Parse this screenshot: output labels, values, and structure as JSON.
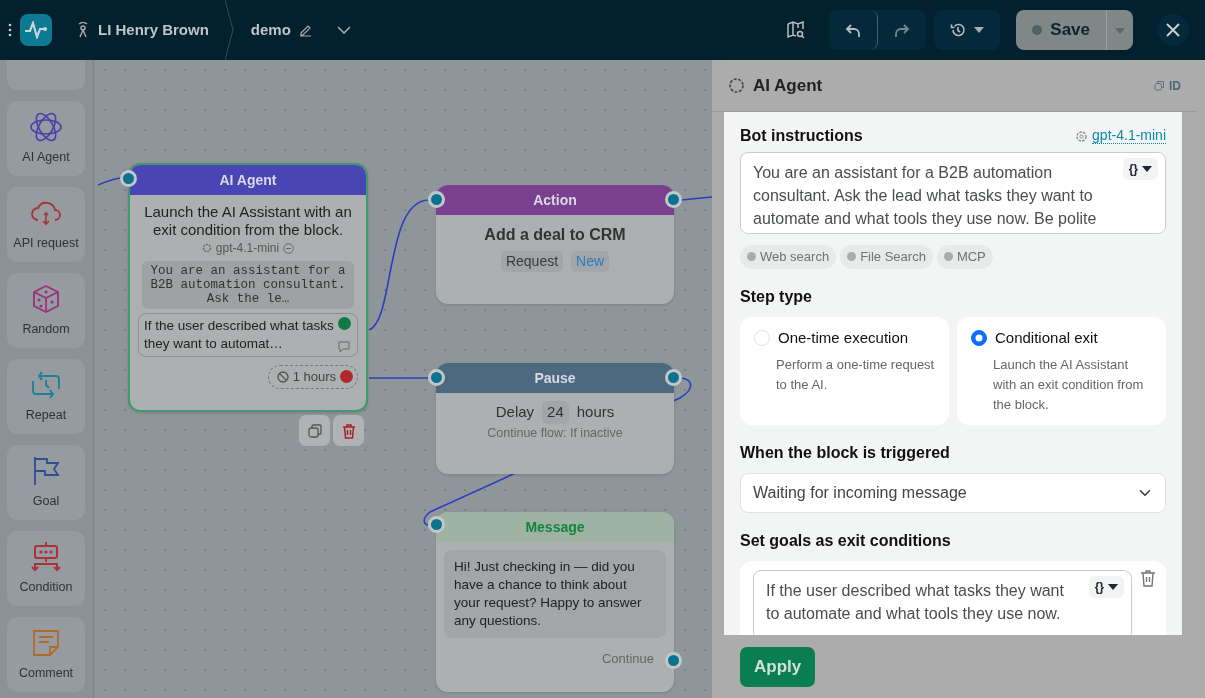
{
  "topbar": {
    "account_name": "LI Henry Brown",
    "flow_name": "demo",
    "save_label": "Save"
  },
  "palette": {
    "items": [
      {
        "label": "AI Agent"
      },
      {
        "label": "API request"
      },
      {
        "label": "Random"
      },
      {
        "label": "Repeat"
      },
      {
        "label": "Goal"
      },
      {
        "label": "Condition"
      },
      {
        "label": "Comment"
      }
    ]
  },
  "canvas": {
    "ai_node": {
      "title": "AI Agent",
      "description": "Launch the AI Assistant with an exit condition from the block.",
      "model": "gpt-4.1-mini",
      "prompt": "You are an assistant for a B2B automation consultant. Ask the le…",
      "condition": "If the user described what tasks they want to automat…",
      "timeout": "1 hours"
    },
    "action_node": {
      "title": "Action",
      "heading": "Add a deal to CRM",
      "tags": [
        {
          "label": "Request",
          "kind": "plain"
        },
        {
          "label": "New",
          "kind": "link"
        }
      ]
    },
    "pause_node": {
      "title": "Pause",
      "prefix": "Delay",
      "amount": "24",
      "unit": "hours",
      "note": "Continue flow: If inactive"
    },
    "message_node": {
      "title": "Message",
      "text": "Hi! Just checking in — did you have a chance to think about your request? Happy to answer any questions.",
      "continue_label": "Continue"
    }
  },
  "panel": {
    "title": "AI Agent",
    "id_label": "ID",
    "instructions": {
      "label": "Bot instructions",
      "model": "gpt-4.1-mini",
      "value": "You are an assistant for a B2B automation consultant. Ask the lead what tasks they want to automate and what tools they use now. Be polite",
      "var_label": "{}"
    },
    "tools": [
      {
        "label": "Web search"
      },
      {
        "label": "File Search"
      },
      {
        "label": "MCP"
      }
    ],
    "step_type": {
      "label": "Step type",
      "options": [
        {
          "title": "One-time execution",
          "description": "Perform a one-time request to the AI.",
          "selected": false
        },
        {
          "title": "Conditional exit",
          "description": "Launch the AI Assistant with an exit condition from the block.",
          "selected": true
        }
      ]
    },
    "trigger": {
      "label": "When the block is triggered",
      "value": "Waiting for incoming message"
    },
    "goals": {
      "label": "Set goals as exit conditions",
      "items": [
        {
          "value": "If the user described what tasks they want to automate and what tools they use now.",
          "var_label": "{}"
        }
      ]
    },
    "apply_label": "Apply"
  }
}
